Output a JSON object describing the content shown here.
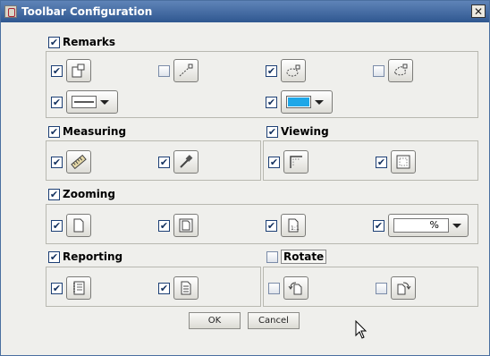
{
  "window": {
    "title": "Toolbar Configuration",
    "close_glyph": "✕"
  },
  "sections": {
    "remarks": {
      "label": "Remarks",
      "checked": true
    },
    "measuring": {
      "label": "Measuring",
      "checked": true
    },
    "viewing": {
      "label": "Viewing",
      "checked": true
    },
    "zooming": {
      "label": "Zooming",
      "checked": true
    },
    "reporting": {
      "label": "Reporting",
      "checked": true
    },
    "rotate": {
      "label": "Rotate",
      "checked": false
    }
  },
  "remarks_items": [
    {
      "icon": "note-icon",
      "checked": true
    },
    {
      "icon": "line-icon",
      "checked": false
    },
    {
      "icon": "ellipse-icon",
      "checked": true
    },
    {
      "icon": "cloud-icon",
      "checked": false
    },
    {
      "icon": "line-style-combo",
      "checked": true
    },
    {
      "icon": "color-combo",
      "checked": true,
      "color": "#1ea7e8"
    }
  ],
  "measuring_items": [
    {
      "icon": "ruler-icon",
      "checked": true
    },
    {
      "icon": "eyedropper-icon",
      "checked": true
    }
  ],
  "viewing_items": [
    {
      "icon": "corner-view-icon",
      "checked": true
    },
    {
      "icon": "frame-view-icon",
      "checked": true
    }
  ],
  "zooming_items": [
    {
      "icon": "fit-page-icon",
      "checked": true
    },
    {
      "icon": "fit-width-icon",
      "checked": true
    },
    {
      "icon": "actual-size-icon",
      "checked": true
    },
    {
      "icon": "zoom-percent-combo",
      "checked": true,
      "value": "%"
    }
  ],
  "reporting_items": [
    {
      "icon": "notebook-icon",
      "checked": true
    },
    {
      "icon": "report-icon",
      "checked": true
    }
  ],
  "rotate_items": [
    {
      "icon": "rotate-left-icon",
      "checked": false
    },
    {
      "icon": "rotate-right-icon",
      "checked": false
    }
  ],
  "buttons": {
    "ok": "OK",
    "cancel": "Cancel"
  },
  "colors": {
    "title_bar": "#3a62a0",
    "accent_swatch": "#1ea7e8"
  }
}
